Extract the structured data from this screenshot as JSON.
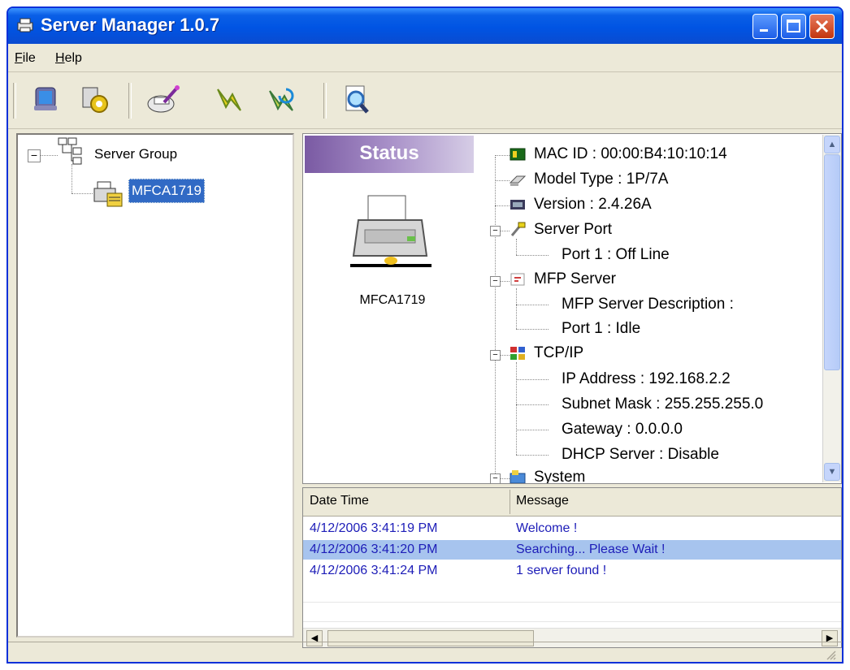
{
  "window": {
    "title": "Server Manager 1.0.7"
  },
  "menubar": {
    "file": {
      "mnemonic": "F",
      "rest": "ile"
    },
    "help": {
      "mnemonic": "H",
      "rest": "elp"
    }
  },
  "toolbar": {
    "icons": [
      "monitor-icon",
      "settings-gear-icon",
      "configure-wand-icon",
      "flash-icon",
      "flash-reset-icon",
      "search-magnifier-icon"
    ]
  },
  "tree": {
    "root_label": "Server Group",
    "root_toggle": "−",
    "child_label": "MFCA1719"
  },
  "status_panel": {
    "heading": "Status",
    "device_label": "MFCA1719",
    "properties": {
      "mac": "MAC ID : 00:00:B4:10:10:14",
      "model": "Model Type : 1P/7A",
      "version": "Version : 2.4.26A",
      "server_port": "Server Port",
      "port1_status": "Port 1 : Off Line",
      "mfp_server": "MFP Server",
      "mfp_desc": "MFP Server Description :",
      "mfp_port1": "Port 1 : Idle",
      "tcpip": "TCP/IP",
      "ip": "IP Address : 192.168.2.2",
      "subnet": "Subnet Mask : 255.255.255.0",
      "gateway": "Gateway : 0.0.0.0",
      "dhcp": "DHCP Server : Disable",
      "system": "System"
    },
    "toggle": "−"
  },
  "log": {
    "columns": [
      "Date Time",
      "Message"
    ],
    "rows": [
      {
        "time": "4/12/2006 3:41:19 PM",
        "message": "Welcome !"
      },
      {
        "time": "4/12/2006 3:41:20 PM",
        "message": "Searching... Please Wait !"
      },
      {
        "time": "4/12/2006 3:41:24 PM",
        "message": "1 server found !"
      }
    ],
    "selected_row": 1
  },
  "colors": {
    "titlebar": "#0054e3",
    "selection": "#a7c4ee",
    "status_heading": "#7a5aa3",
    "log_text": "#1d1db8"
  }
}
